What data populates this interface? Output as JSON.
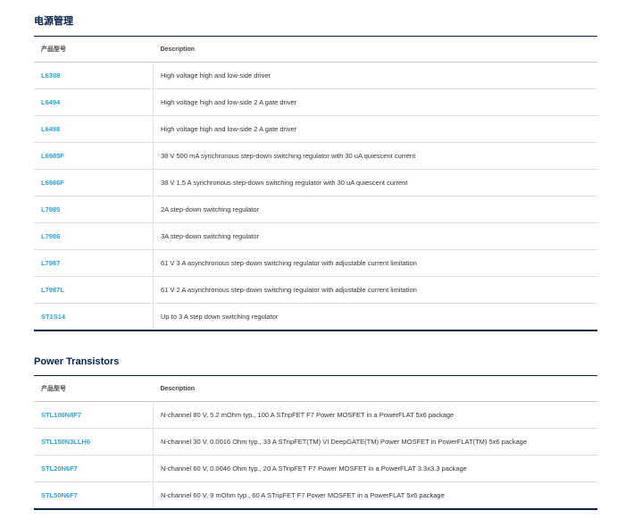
{
  "sections": [
    {
      "title": "电源管理",
      "col_product": "产品型号",
      "col_desc": "Description",
      "rows": [
        {
          "part": "L6398",
          "desc": "High voltage high and low-side driver"
        },
        {
          "part": "L6494",
          "desc": "High voltage high and low-side 2 A gate driver"
        },
        {
          "part": "L6498",
          "desc": "High voltage high and low-side 2 A gate driver"
        },
        {
          "part": "L6985F",
          "desc": "38 V 500 mA synchronous step-down switching regulator with 30 uA quiescent current"
        },
        {
          "part": "L6986F",
          "desc": "38 V 1.5 A synchronous step-down switching regulator with 30 uA quiescent current"
        },
        {
          "part": "L7985",
          "desc": "2A step-down switching regulator"
        },
        {
          "part": "L7986",
          "desc": "3A step-down switching regulator"
        },
        {
          "part": "L7987",
          "desc": "61 V 3 A asynchronous step-down switching regulator with adjustable current limitation"
        },
        {
          "part": "L7987L",
          "desc": "61 V 2 A asynchronous step-down switching regulator with adjustable current limitation"
        },
        {
          "part": "ST1S14",
          "desc": "Up to 3 A step down switching regulator"
        }
      ]
    },
    {
      "title": "Power Transistors",
      "col_product": "产品型号",
      "col_desc": "Description",
      "rows": [
        {
          "part": "STL100N8F7",
          "desc": "N-channel 80 V, 5.2 mOhm typ., 100 A STripFET F7 Power MOSFET in a PowerFLAT 5x6 package"
        },
        {
          "part": "STL150N3LLH6",
          "desc": "N-channel 30 V, 0.0016 Ohm typ., 33 A STripFET(TM) VI DeepGATE(TM) Power MOSFET in PowerFLAT(TM) 5x6 package"
        },
        {
          "part": "STL20N6F7",
          "desc": "N-channel 60 V, 0.0046 Ohm typ., 20 A STripFET F7 Power MOSFET in a PowerFLAT 3.3x3.3 package"
        },
        {
          "part": "STL50N6F7",
          "desc": "N-channel 60 V, 9 mOhm typ., 60 A STripFET F7 Power MOSFET in a PowerFLAT 5x6 package"
        }
      ]
    }
  ]
}
